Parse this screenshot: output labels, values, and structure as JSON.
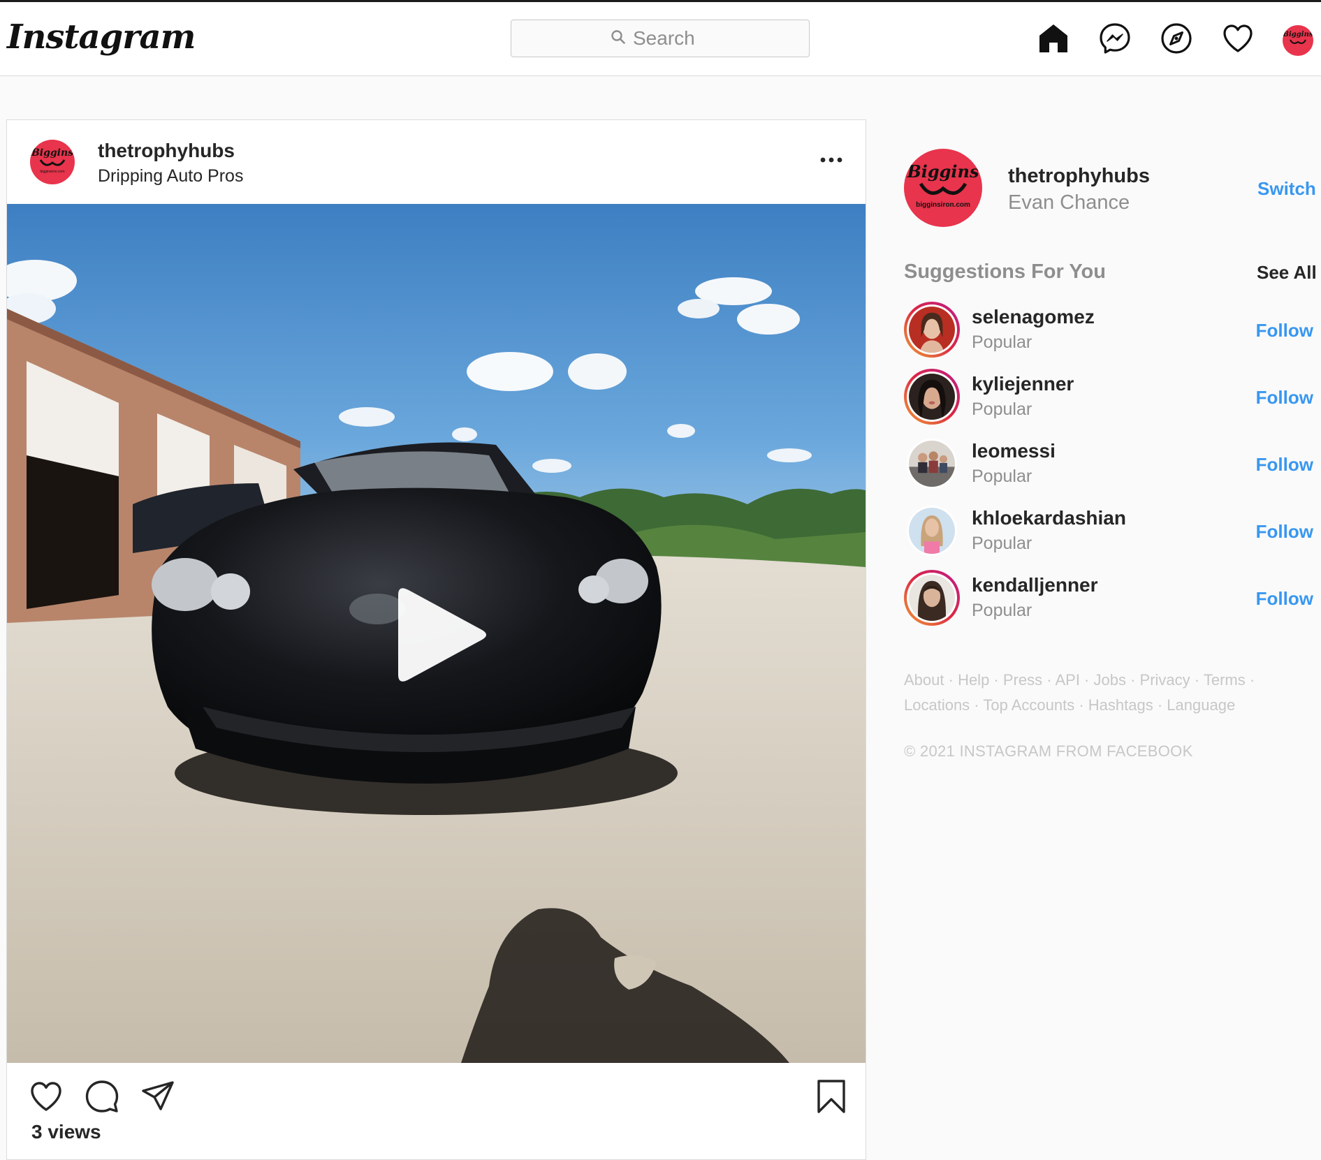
{
  "header": {
    "logo": "Instagram",
    "search_placeholder": "Search"
  },
  "avatar_text": {
    "brand": "Biggins",
    "url": "bigginsiron.com"
  },
  "post": {
    "username": "thetrophyhubs",
    "location": "Dripping Auto Pros",
    "views": "3 views"
  },
  "sidebar": {
    "username": "thetrophyhubs",
    "full_name": "Evan Chance",
    "switch_label": "Switch",
    "suggestions_title": "Suggestions For You",
    "see_all_label": "See All",
    "suggestions": [
      {
        "username": "selenagomez",
        "subtitle": "Popular",
        "action": "Follow"
      },
      {
        "username": "kyliejenner",
        "subtitle": "Popular",
        "action": "Follow"
      },
      {
        "username": "leomessi",
        "subtitle": "Popular",
        "action": "Follow"
      },
      {
        "username": "khloekardashian",
        "subtitle": "Popular",
        "action": "Follow"
      },
      {
        "username": "kendalljenner",
        "subtitle": "Popular",
        "action": "Follow"
      }
    ],
    "footer_links": [
      "About",
      "Help",
      "Press",
      "API",
      "Jobs",
      "Privacy",
      "Terms",
      "Locations",
      "Top Accounts",
      "Hashtags",
      "Language"
    ],
    "copyright": "© 2021 INSTAGRAM FROM FACEBOOK"
  },
  "colors": {
    "link_blue": "#3897f0",
    "muted_gray": "#8e8e8e",
    "text_dark": "#262626",
    "brand_red": "#e8344c"
  },
  "icons": {
    "nav": [
      "home-icon",
      "messenger-icon",
      "explore-icon",
      "activity-heart-icon"
    ],
    "post_actions": [
      "like-heart-icon",
      "comment-icon",
      "share-icon",
      "bookmark-icon"
    ]
  }
}
